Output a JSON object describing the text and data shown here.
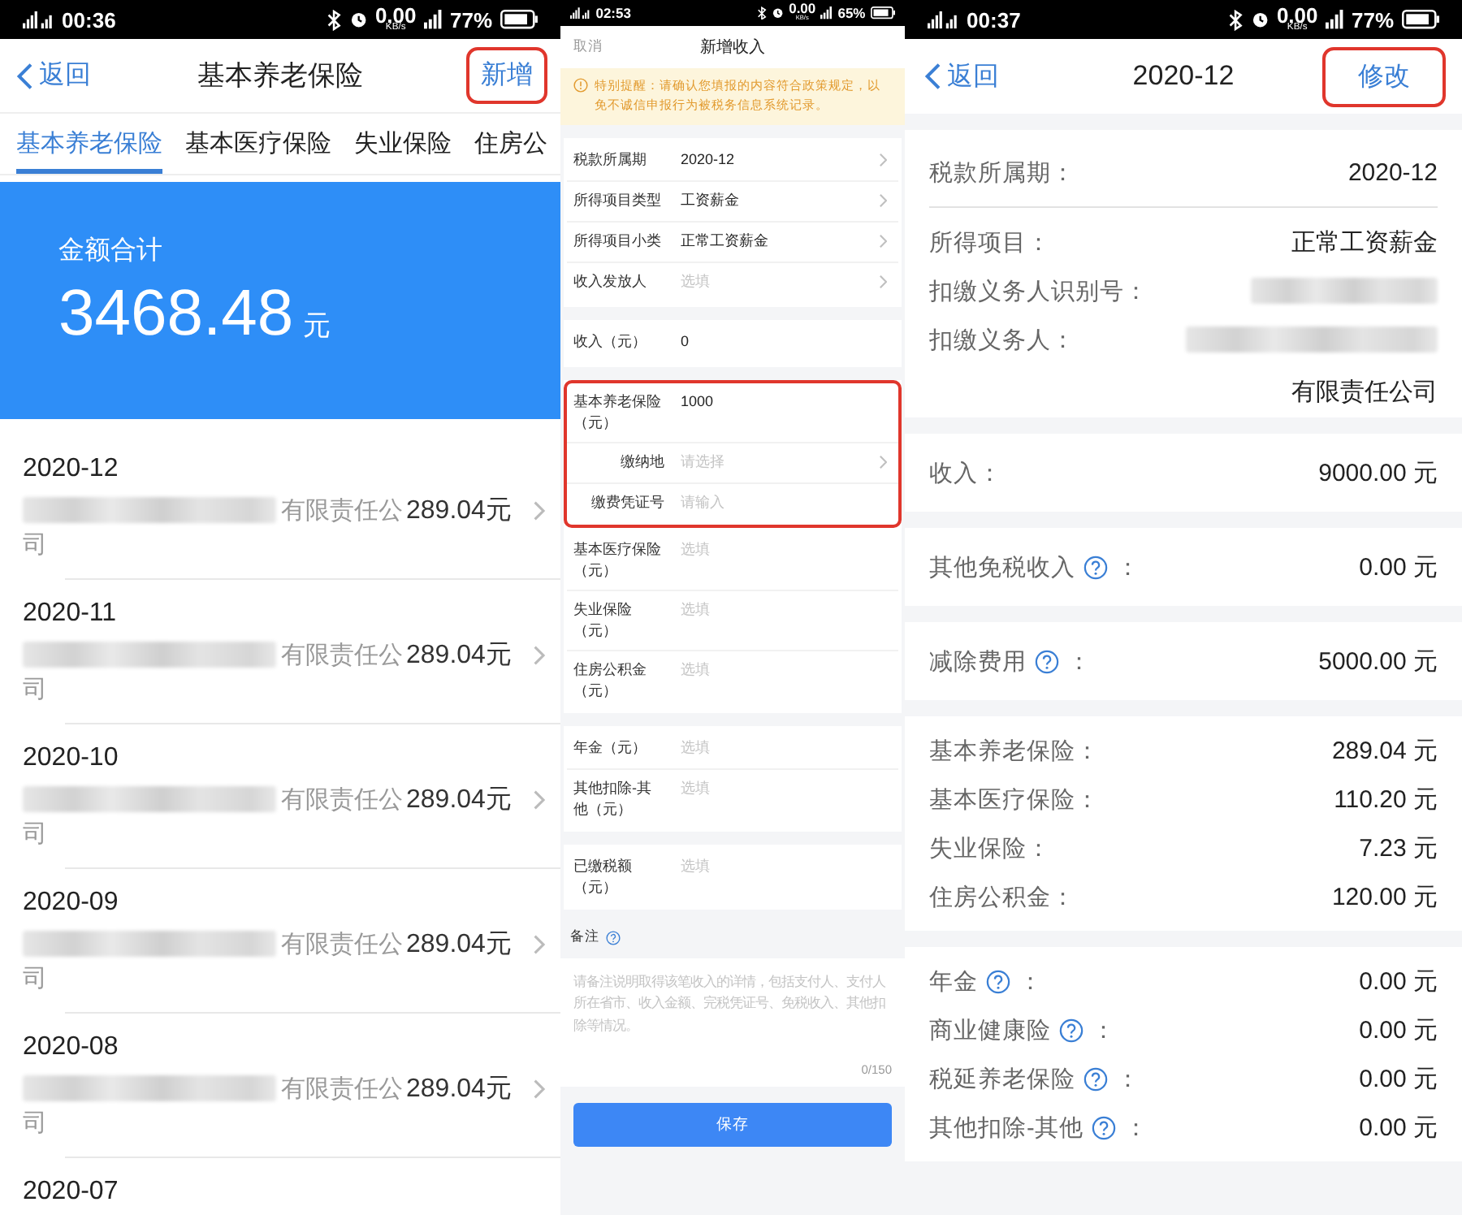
{
  "screens": [
    {
      "kind": "list",
      "status_bar": {
        "time": "00:36",
        "speed": "0.00",
        "speed_unit": "KB/s",
        "battery": "77%"
      },
      "nav": {
        "back": "返回",
        "title": "基本养老保险",
        "action": "新增",
        "action_highlighted": true
      },
      "tabs": [
        {
          "label": "基本养老保险",
          "selected": true
        },
        {
          "label": "基本医疗保险",
          "selected": false
        },
        {
          "label": "失业保险",
          "selected": false
        },
        {
          "label": "住房公",
          "selected": false
        }
      ],
      "summary": {
        "label": "金额合计",
        "amount": "3468.48",
        "unit": "元"
      },
      "records": [
        {
          "date": "2020-12",
          "redacted": true,
          "employer": "有限责任公",
          "employer_cont": "司",
          "amount": "289.04元"
        },
        {
          "date": "2020-11",
          "redacted": true,
          "employer": "有限责任公",
          "employer_cont": "司",
          "amount": "289.04元"
        },
        {
          "date": "2020-10",
          "redacted": true,
          "employer": "有限责任公",
          "employer_cont": "司",
          "amount": "289.04元"
        },
        {
          "date": "2020-09",
          "redacted": true,
          "employer": "有限责任公",
          "employer_cont": "司",
          "amount": "289.04元"
        },
        {
          "date": "2020-08",
          "redacted": true,
          "employer": "有限责任公",
          "employer_cont": "司",
          "amount": "289.04元"
        },
        {
          "date": "2020-07"
        }
      ]
    },
    {
      "kind": "form",
      "status_bar": {
        "time": "02:53",
        "speed": "0.00",
        "speed_unit": "KB/s",
        "battery": "65%"
      },
      "nav": {
        "cancel": "取消",
        "title": "新增收入"
      },
      "notice": "特别提醒：请确认您填报的内容符合政策规定，以免不诚信申报行为被税务信息系统记录。",
      "blocks": [
        {
          "parts": [
            {
              "highlighted": false,
              "fields": [
                {
                  "kind": "select",
                  "label": "税款所属期",
                  "value": "2020-12"
                },
                {
                  "kind": "select",
                  "label": "所得项目类型",
                  "value": "工资薪金"
                },
                {
                  "kind": "select",
                  "label": "所得项目小类",
                  "value": "正常工资薪金"
                },
                {
                  "kind": "select",
                  "label": "收入发放人",
                  "placeholder": "选填"
                }
              ]
            }
          ]
        },
        {
          "parts": [
            {
              "highlighted": false,
              "fields": [
                {
                  "kind": "input",
                  "label": "收入（元）",
                  "value": "0"
                }
              ]
            }
          ]
        },
        {
          "parts": [
            {
              "highlighted": true,
              "fields": [
                {
                  "kind": "input",
                  "label": "基本养老保险（元）",
                  "value": "1000"
                },
                {
                  "kind": "sub-select",
                  "label": "缴纳地",
                  "placeholder": "请选择"
                },
                {
                  "kind": "sub-input",
                  "label": "缴费凭证号",
                  "placeholder": "请输入"
                }
              ]
            },
            {
              "highlighted": false,
              "fields": [
                {
                  "kind": "input",
                  "label": "基本医疗保险（元）",
                  "placeholder": "选填"
                },
                {
                  "kind": "input",
                  "label": "失业保险（元）",
                  "placeholder": "选填"
                },
                {
                  "kind": "input",
                  "label": "住房公积金（元）",
                  "placeholder": "选填"
                }
              ]
            }
          ]
        },
        {
          "parts": [
            {
              "highlighted": false,
              "fields": [
                {
                  "kind": "input",
                  "label": "年金（元）",
                  "placeholder": "选填"
                },
                {
                  "kind": "input",
                  "label": "其他扣除-其他（元）",
                  "placeholder": "选填"
                }
              ]
            }
          ]
        },
        {
          "parts": [
            {
              "highlighted": false,
              "fields": [
                {
                  "kind": "input",
                  "label": "已缴税额（元）",
                  "placeholder": "选填"
                }
              ]
            }
          ]
        }
      ],
      "remark": {
        "label": "备注",
        "placeholder": "请备注说明取得该笔收入的详情，包括支付人、支付人所在省市、收入金额、完税凭证号、免税收入、其他扣除等情况。",
        "counter": "0/150"
      },
      "save": "保存"
    },
    {
      "kind": "detail",
      "status_bar": {
        "time": "00:37",
        "speed": "0.00",
        "speed_unit": "KB/s",
        "battery": "77%"
      },
      "nav": {
        "back": "返回",
        "title": "2020-12",
        "action": "修改",
        "action_highlighted": true
      },
      "sections": [
        {
          "rows": [
            {
              "kind": "period",
              "label": "税款所属期：",
              "value": "2020-12"
            },
            {
              "kind": "field",
              "label": "所得项目：",
              "value": "正常工资薪金"
            },
            {
              "kind": "redacted",
              "label": "扣缴义务人识别号："
            },
            {
              "kind": "redacted",
              "label": "扣缴义务人：",
              "value": "有限责任公司"
            }
          ]
        },
        {
          "rows": [
            {
              "kind": "field",
              "label": "收入：",
              "value": "9000.00 元"
            }
          ]
        },
        {
          "rows": [
            {
              "kind": "help",
              "label": "其他免税收入",
              "colon": "：",
              "value": "0.00 元"
            }
          ]
        },
        {
          "rows": [
            {
              "kind": "help",
              "label": "减除费用",
              "colon": "：",
              "value": "5000.00 元"
            }
          ]
        },
        {
          "rows": [
            {
              "kind": "field",
              "label": "基本养老保险：",
              "value": "289.04 元"
            },
            {
              "kind": "field",
              "label": "基本医疗保险：",
              "value": "110.20 元"
            },
            {
              "kind": "field",
              "label": "失业保险：",
              "value": "7.23 元"
            },
            {
              "kind": "field",
              "label": "住房公积金：",
              "value": "120.00 元"
            }
          ]
        },
        {
          "rows": [
            {
              "kind": "help",
              "label": "年金",
              "colon": "：",
              "value": "0.00 元"
            },
            {
              "kind": "help",
              "label": "商业健康险",
              "colon": "：",
              "value": "0.00 元"
            },
            {
              "kind": "help",
              "label": "税延养老保险",
              "colon": "：",
              "value": "0.00 元"
            },
            {
              "kind": "help",
              "label": "其他扣除-其他",
              "colon": "：",
              "value": "0.00 元"
            }
          ]
        }
      ]
    }
  ]
}
